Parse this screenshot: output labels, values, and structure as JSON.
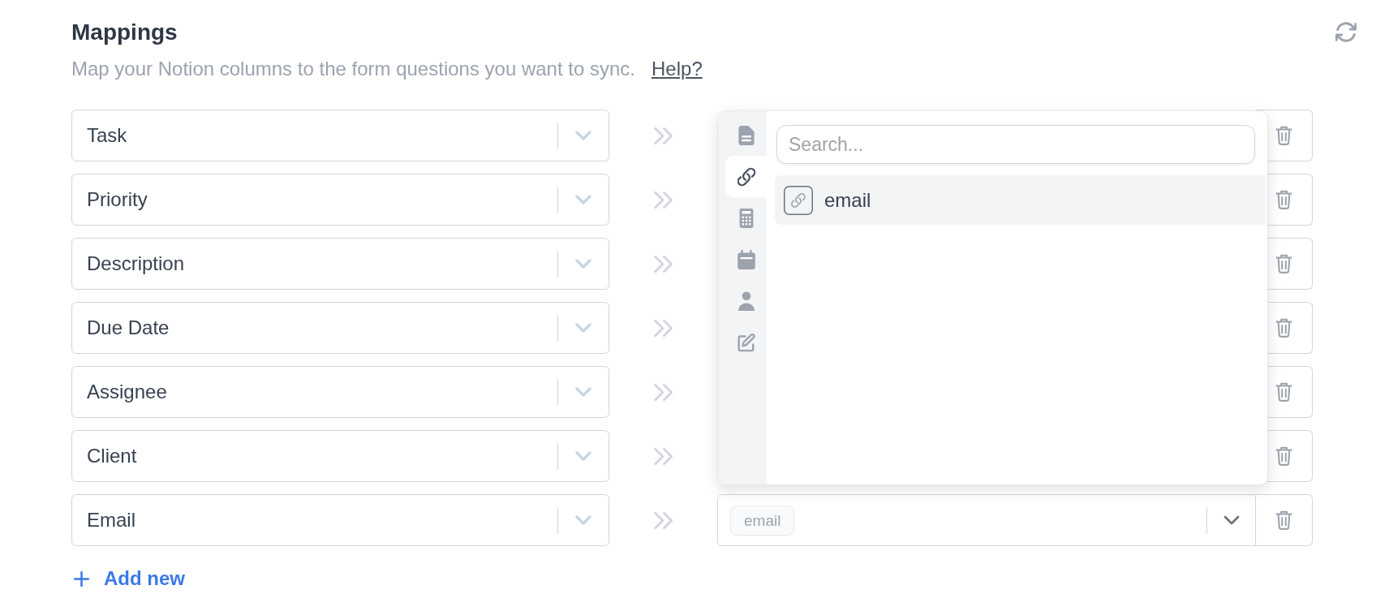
{
  "header": {
    "title": "Mappings",
    "description": "Map your Notion columns to the form questions you want to sync.",
    "help_link": "Help?"
  },
  "mappings": [
    {
      "column": "Task"
    },
    {
      "column": "Priority"
    },
    {
      "column": "Description"
    },
    {
      "column": "Due Date"
    },
    {
      "column": "Assignee"
    },
    {
      "column": "Client"
    },
    {
      "column": "Email",
      "question_tags": [
        "email"
      ]
    }
  ],
  "dropdown": {
    "categories": [
      {
        "kind": "text",
        "selected": false
      },
      {
        "kind": "url",
        "selected": true
      },
      {
        "kind": "number",
        "selected": false
      },
      {
        "kind": "date",
        "selected": false
      },
      {
        "kind": "person",
        "selected": false
      },
      {
        "kind": "form",
        "selected": false
      }
    ],
    "search": {
      "placeholder": "Search..."
    },
    "options": [
      {
        "label": "email",
        "kind": "url",
        "selected": true
      }
    ]
  },
  "add_button": {
    "label": "Add new"
  }
}
